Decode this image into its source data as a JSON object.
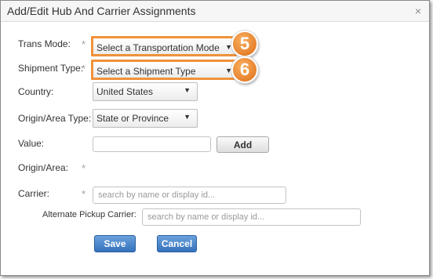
{
  "dialog": {
    "title": "Add/Edit Hub And Carrier Assignments",
    "close_icon": "×"
  },
  "form": {
    "trans_mode": {
      "label": "Trans Mode:",
      "value": "Select a Transportation Mode",
      "badge": "5"
    },
    "shipment_type": {
      "label": "Shipment Type:",
      "value": "Select a Shipment Type",
      "badge": "6"
    },
    "country": {
      "label": "Country:",
      "value": "United States"
    },
    "origin_area_type": {
      "label": "Origin/Area Type:",
      "value": "State or Province"
    },
    "value_field": {
      "label": "Value:",
      "value": "",
      "add_button": "Add"
    },
    "origin_area": {
      "label": "Origin/Area:"
    },
    "carrier": {
      "label": "Carrier:",
      "placeholder": "search by name or display id..."
    },
    "alternate_pickup_carrier": {
      "label": "Alternate Pickup Carrier:",
      "placeholder": "search by name or display id..."
    },
    "required_marker": "*",
    "dropdown_arrow": "▼"
  },
  "buttons": {
    "save": "Save",
    "cancel": "Cancel"
  },
  "colors": {
    "highlight": "#f0913b",
    "primary_button": "#3472bd"
  }
}
